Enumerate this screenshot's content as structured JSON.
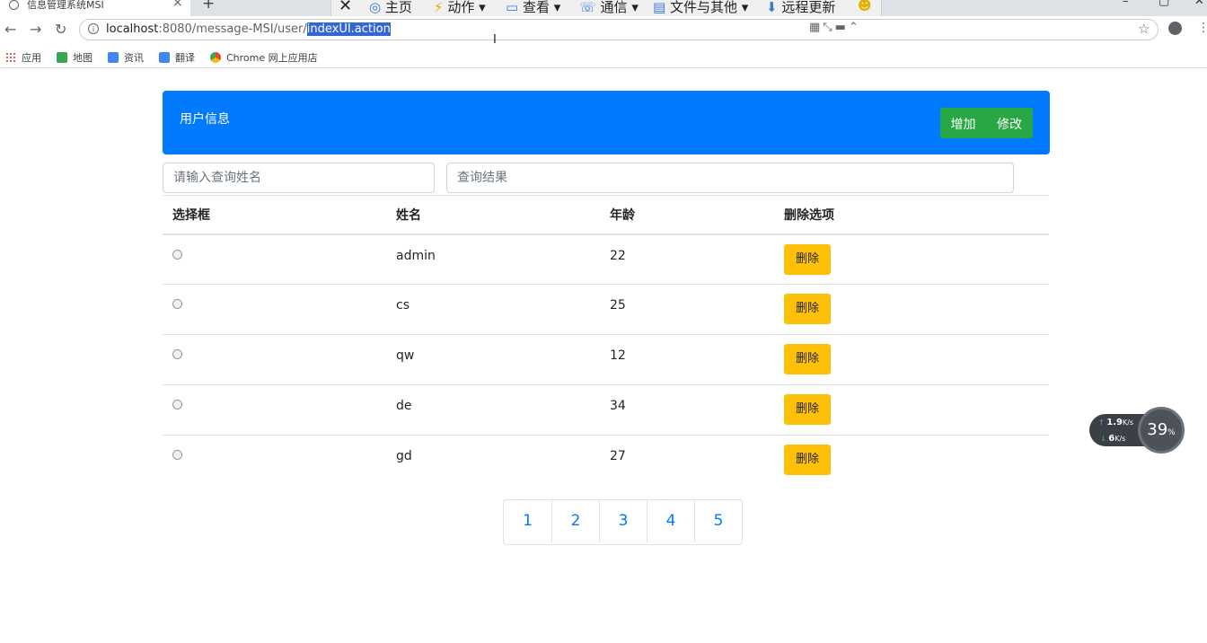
{
  "browser": {
    "tab_title": "信息管理系统MSI",
    "tab_close": "×",
    "new_tab": "+",
    "window_minimize": "–",
    "window_restore": "▢",
    "window_close": "✕",
    "url_host": "localhost",
    "url_path": ":8080/message-MSI/user/",
    "url_selected": "indexUI.action",
    "info_icon": "i",
    "star": "☆",
    "menu": "⋮"
  },
  "remote_toolbar": {
    "close": "✕",
    "home": "主页",
    "action": "动作",
    "view": "查看",
    "comm": "通信",
    "files": "文件与其他",
    "update": "远程更新"
  },
  "bookmarks": [
    {
      "label": "应用",
      "color": "#e8453c"
    },
    {
      "label": "地图",
      "color": "#34a853"
    },
    {
      "label": "资讯",
      "color": "#4285f4"
    },
    {
      "label": "翻译",
      "color": "#4285f4"
    },
    {
      "label": "Chrome 网上应用店",
      "color": "#ea4335"
    }
  ],
  "header": {
    "title": "用户信息",
    "add_label": "增加",
    "edit_label": "修改"
  },
  "search": {
    "name_placeholder": "请输入查询姓名",
    "result_placeholder": "查询结果"
  },
  "table": {
    "headers": [
      "选择框",
      "姓名",
      "年龄",
      "删除选项"
    ],
    "delete_label": "删除",
    "rows": [
      {
        "name": "admin",
        "age": "22"
      },
      {
        "name": "cs",
        "age": "25"
      },
      {
        "name": "qw",
        "age": "12"
      },
      {
        "name": "de",
        "age": "34"
      },
      {
        "name": "gd",
        "age": "27"
      }
    ]
  },
  "pagination": [
    "1",
    "2",
    "3",
    "4",
    "5"
  ],
  "net_widget": {
    "up": "1.9",
    "up_unit": "K/s",
    "down": "6",
    "down_unit": "K/s",
    "percent": "39",
    "percent_unit": "%"
  },
  "colors": {
    "primary": "#007bff",
    "success": "#28a745",
    "warning": "#ffc107"
  }
}
